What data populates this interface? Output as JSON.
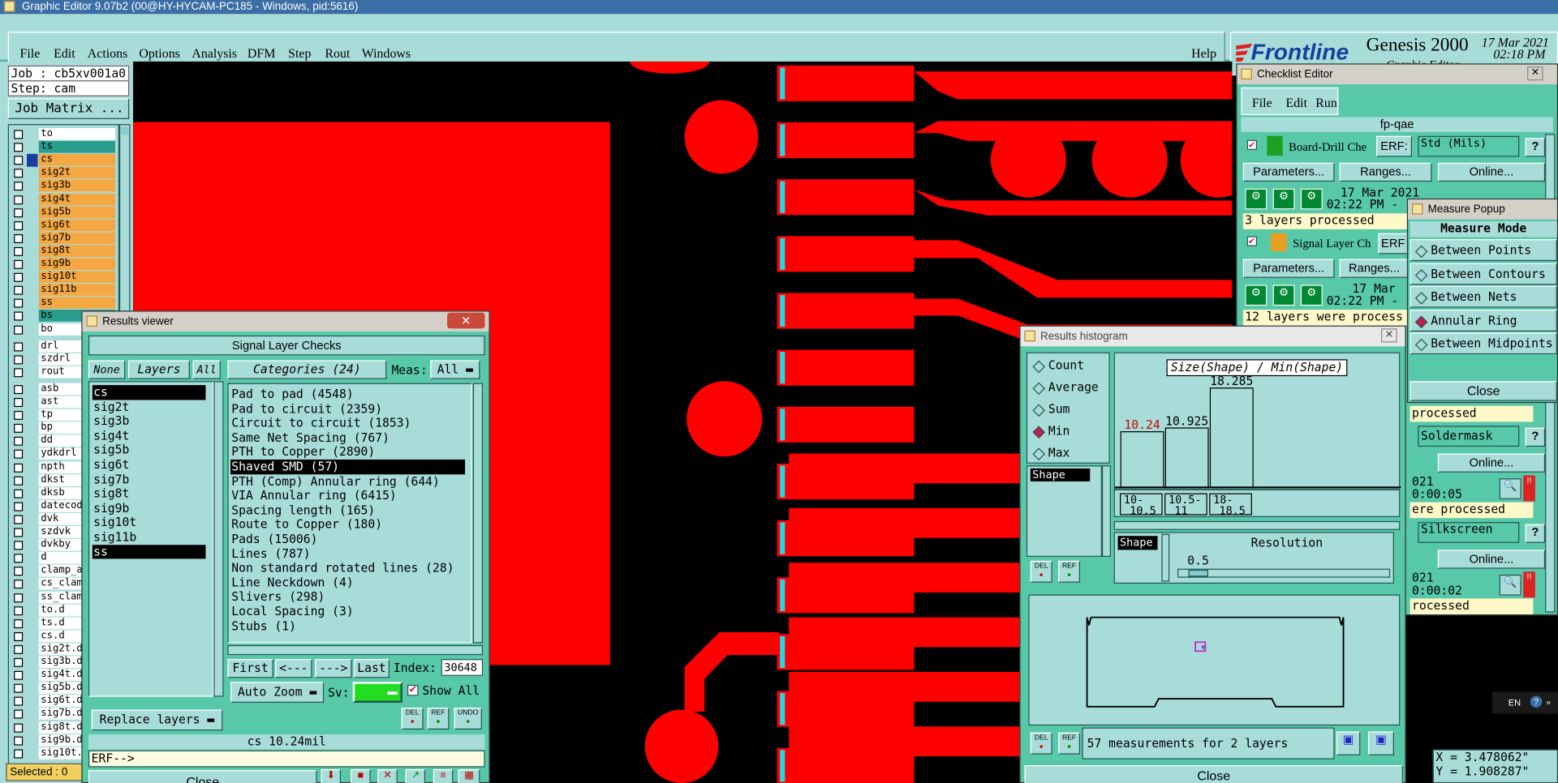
{
  "window": {
    "title": "Graphic Editor 9.07b2 (00@HY-HYCAM-PC185 - Windows, pid:5616)"
  },
  "menu": {
    "items": [
      "File",
      "Edit",
      "Actions",
      "Options",
      "Analysis",
      "DFM",
      "Step",
      "Rout",
      "Windows"
    ],
    "help": "Help"
  },
  "brand": {
    "logo": "Frontline",
    "product": "Genesis 2000",
    "subtitle": "Graphic Editor",
    "date": "17 Mar 2021",
    "time": "02:18 PM"
  },
  "job": {
    "job": "Job : cb5xv001a0",
    "step": "Step: cam",
    "matrix_button": "Job Matrix ...",
    "selected": "Selected : 0"
  },
  "layers": {
    "board": [
      {
        "name": "to",
        "color": "#ffffff"
      },
      {
        "name": "ts",
        "color": "#2a9d8f"
      },
      {
        "name": "cs",
        "color": "#f4a742"
      },
      {
        "name": "sig2t",
        "color": "#f4a742"
      },
      {
        "name": "sig3b",
        "color": "#f4a742"
      },
      {
        "name": "sig4t",
        "color": "#f4a742"
      },
      {
        "name": "sig5b",
        "color": "#f4a742"
      },
      {
        "name": "sig6t",
        "color": "#f4a742"
      },
      {
        "name": "sig7b",
        "color": "#f4a742"
      },
      {
        "name": "sig8t",
        "color": "#f4a742"
      },
      {
        "name": "sig9b",
        "color": "#f4a742"
      },
      {
        "name": "sig10t",
        "color": "#f4a742"
      },
      {
        "name": "sig11b",
        "color": "#f4a742"
      },
      {
        "name": "ss",
        "color": "#f4a742"
      },
      {
        "name": "bs",
        "color": "#2a9d8f"
      },
      {
        "name": "bo",
        "color": "#ffffff"
      }
    ],
    "drill": [
      "drl",
      "szdrl",
      "rout"
    ],
    "misc": [
      "asb",
      "ast",
      "tp",
      "bp",
      "dd",
      "ydkdrl",
      "npth",
      "dkst",
      "dksb",
      "datecod",
      "dvk",
      "szdvk",
      "dvkby",
      "d",
      "clamp_a",
      "cs_clam",
      "ss_clam",
      "to.d",
      "ts.d",
      "cs.d",
      "sig2t.d",
      "sig3b.d",
      "sig4t.d",
      "sig5b.d",
      "sig6t.d",
      "sig7b.d",
      "sig8t.d",
      "sig9b.d",
      "sig10t."
    ]
  },
  "results_viewer": {
    "title": "Results viewer",
    "header": "Signal Layer Checks",
    "none": "None",
    "layers_label": "Layers",
    "all": "All",
    "categories_label": "Categories (24)",
    "meas_label": "Meas:",
    "meas_value": "All",
    "layer_list": [
      "cs",
      "sig2t",
      "sig3b",
      "sig4t",
      "sig5b",
      "sig6t",
      "sig7b",
      "sig8t",
      "sig9b",
      "sig10t",
      "sig11b",
      "ss"
    ],
    "categories": [
      "Pad to pad (4548)",
      "Pad to circuit (2359)",
      "Circuit to circuit (1853)",
      "Same Net Spacing (767)",
      "PTH to Copper (2890)",
      "Shaved SMD (57)",
      "PTH (Comp) Annular ring (644)",
      "VIA Annular ring (6415)",
      "Spacing length (165)",
      "Route to Copper (180)",
      "Pads (15006)",
      "Lines (787)",
      "Non standard rotated lines (28)",
      "Line Neckdown (4)",
      "Slivers (298)",
      "Local Spacing (3)",
      "Stubs (1)"
    ],
    "nav": {
      "first": "First",
      "prev": "<---",
      "next": "--->",
      "last": "Last",
      "index_label": "Index:",
      "index_value": "30648"
    },
    "auto_zoom": "Auto Zoom",
    "sv_label": "Sv:",
    "show_all": "Show All",
    "replace_layers": "Replace layers",
    "del": "DEL",
    "ref": "REF",
    "undo": "UNDO",
    "status": "cs 10.24mil",
    "erf": "ERF-->",
    "close": "Close"
  },
  "checklist": {
    "title": "Checklist Editor",
    "menu": [
      "File",
      "Edit",
      "Run"
    ],
    "name": "fp-qae",
    "row1": {
      "check": "Board-Drill Che",
      "erf": "ERF:",
      "std": "Std (Mils)",
      "date": "17 Mar 2021",
      "time": "02:22 PM -",
      "status": "3 layers processed"
    },
    "row2": {
      "check": "Signal Layer Ch",
      "erf": "ERF",
      "date": "17 Mar",
      "time": "02:22 PM -",
      "status": "12 layers were process"
    },
    "row3": {
      "status": "processed",
      "std": "Soldermask",
      "date": "021",
      "time": "0:00:05"
    },
    "row4": {
      "status": "ere processed",
      "std": "Silkscreen",
      "date": "021",
      "time": "0:00:02"
    },
    "row5": {
      "status": "rocessed"
    },
    "buttons": {
      "parameters": "Parameters...",
      "ranges": "Ranges...",
      "online": "Online..."
    }
  },
  "measure": {
    "title": "Measure Popup",
    "header": "Measure Mode",
    "options": [
      "Between Points",
      "Between Contours",
      "Between Nets",
      "Annular Ring",
      "Between Midpoints"
    ],
    "selected": "Annular Ring",
    "close": "Close"
  },
  "histogram": {
    "title": "Results histogram",
    "modes": [
      "Count",
      "Average",
      "Sum",
      "Min",
      "Max"
    ],
    "selected_mode": "Min",
    "shape_label": "Shape",
    "chart_title": "Size(Shape) / Min(Shape)",
    "bars": [
      {
        "range": "10-10.5",
        "value": 10.24,
        "color": "#cc0000"
      },
      {
        "range": "10.5-11",
        "value": 10.925,
        "color": "#000000"
      },
      {
        "range": "18-18.5",
        "value": 18.285,
        "color": "#000000"
      }
    ],
    "bins_display": [
      [
        "10-",
        "10.5"
      ],
      [
        "10.5-",
        "11"
      ],
      [
        "18-",
        "18.5"
      ]
    ],
    "resolution_label": "Resolution",
    "resolution_value": "0.5",
    "summary": "57 measurements for 2 layers",
    "close": "Close",
    "del": "DEL",
    "ref": "REF"
  },
  "coords": {
    "x": "X = 3.478062\"",
    "y": "Y = 1.908287\""
  },
  "tray": {
    "lang": "EN"
  }
}
